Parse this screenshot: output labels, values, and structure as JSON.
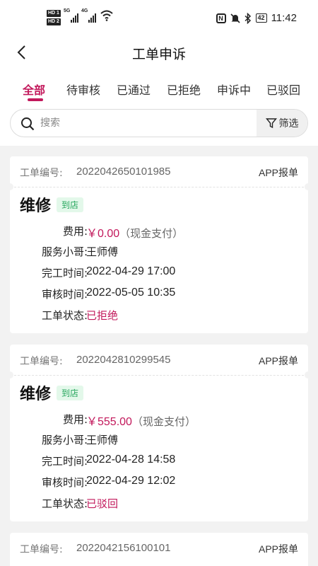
{
  "status_bar": {
    "hd1": "HD 1",
    "hd2": "HD 2",
    "net1": "5G",
    "net2": "4G",
    "battery": "42",
    "time": "11:42"
  },
  "header": {
    "title": "工单申诉"
  },
  "tabs": [
    {
      "label": "全部",
      "active": true
    },
    {
      "label": "待审核",
      "active": false
    },
    {
      "label": "已通过",
      "active": false
    },
    {
      "label": "已拒绝",
      "active": false
    },
    {
      "label": "申诉中",
      "active": false
    },
    {
      "label": "已驳回",
      "active": false
    }
  ],
  "search": {
    "placeholder": "搜索",
    "filter_label": "筛选"
  },
  "labels": {
    "order_no": "工单编号:",
    "fee": "费用:",
    "worker": "服务小哥:",
    "finish_time": "完工时间:",
    "review_time": "审核时间:",
    "status": "工单状态:"
  },
  "orders": [
    {
      "order_no": "2022042650101985",
      "source": "APP报单",
      "service": "维修",
      "badge": "到店",
      "fee": "￥0.00",
      "pay": "（现金支付）",
      "worker": "王师傅",
      "finish_time": "2022-04-29 17:00",
      "review_time": "2022-05-05 10:35",
      "status": "已拒绝"
    },
    {
      "order_no": "2022042810299545",
      "source": "APP报单",
      "service": "维修",
      "badge": "到店",
      "fee": "￥555.00",
      "pay": "（现金支付）",
      "worker": "王师傅",
      "finish_time": "2022-04-28 14:58",
      "review_time": "2022-04-29 12:02",
      "status": "已驳回"
    },
    {
      "order_no": "2022042156100101",
      "source": "APP报单"
    }
  ],
  "colors": {
    "accent": "#c2185b",
    "badge_bg": "#e3f8ea",
    "badge_text": "#22a55a",
    "page_bg": "#f2f2f2"
  },
  "icons": [
    "back-arrow-icon",
    "search-icon",
    "filter-icon",
    "wifi-icon",
    "nfc-icon",
    "silent-icon",
    "bluetooth-icon",
    "battery-icon"
  ]
}
